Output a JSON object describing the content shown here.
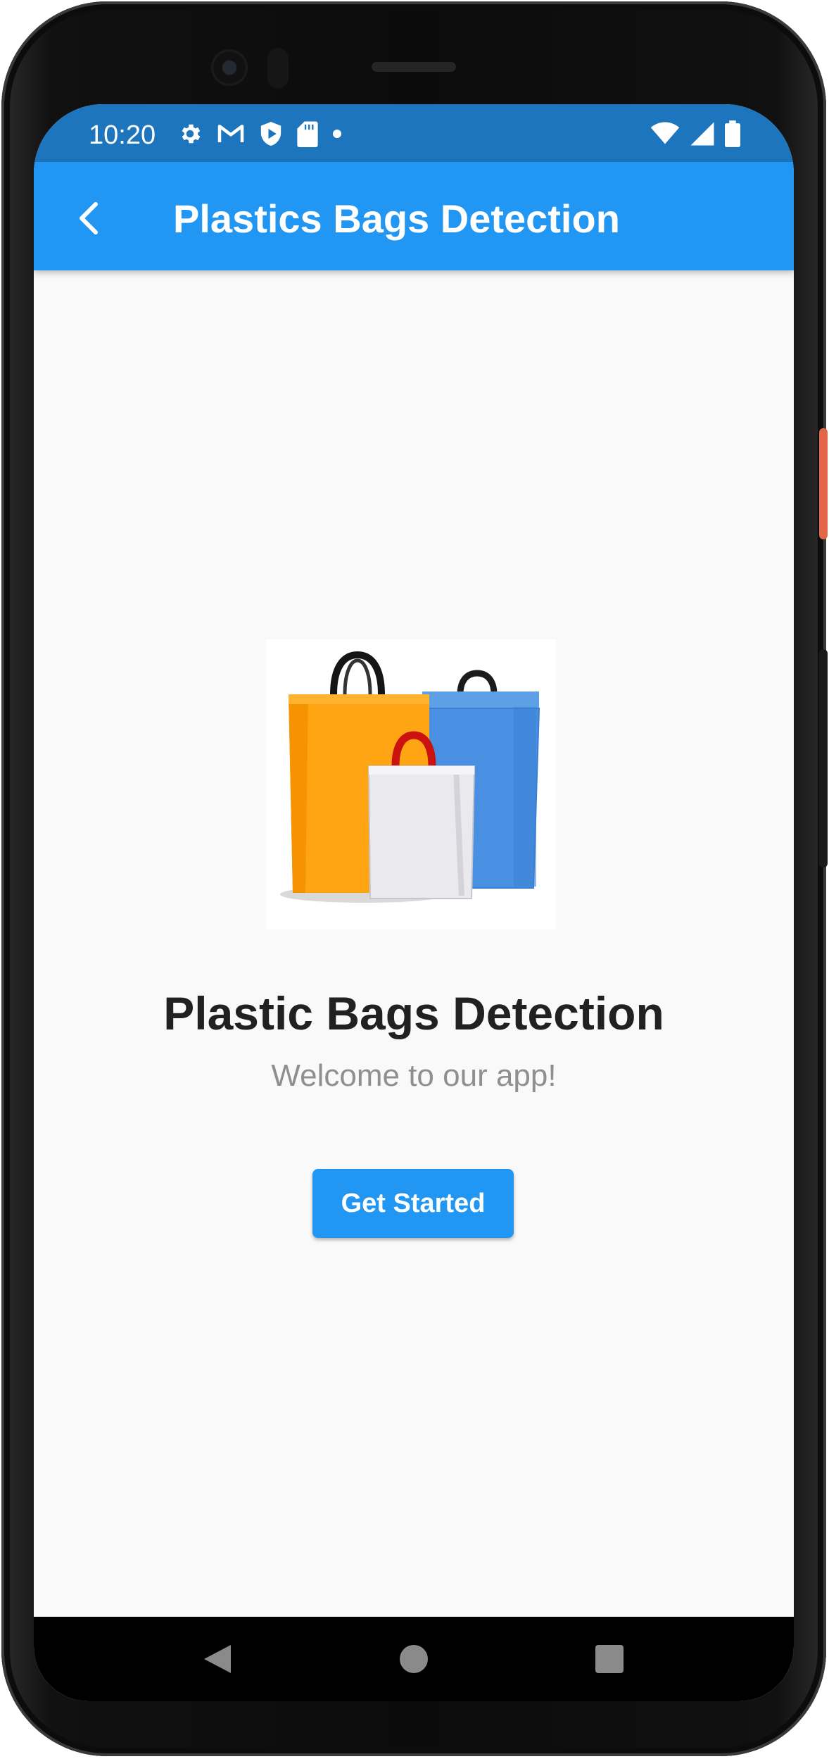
{
  "status_bar": {
    "time": "10:20",
    "left_icons": [
      "settings-gear-icon",
      "gmail-icon",
      "shield-play-icon",
      "sd-card-icon",
      "dot-icon"
    ],
    "right_icons": [
      "wifi-icon",
      "cell-signal-icon",
      "battery-icon"
    ]
  },
  "app_bar": {
    "back_icon": "chevron-left-icon",
    "title": "Plastics Bags Detection",
    "color": "#2196f3"
  },
  "main": {
    "image": "plastic-bags-illustration",
    "headline": "Plastic Bags Detection",
    "subtitle": "Welcome to our app!",
    "cta_label": "Get Started"
  },
  "nav_bar": {
    "buttons": [
      "back-triangle-icon",
      "home-circle-icon",
      "recents-square-icon"
    ]
  },
  "colors": {
    "status_bar": "#1d75bd",
    "accent": "#2196f3",
    "background": "#f9f9f9",
    "headline": "#212121",
    "subtitle": "#8f8f8f"
  }
}
